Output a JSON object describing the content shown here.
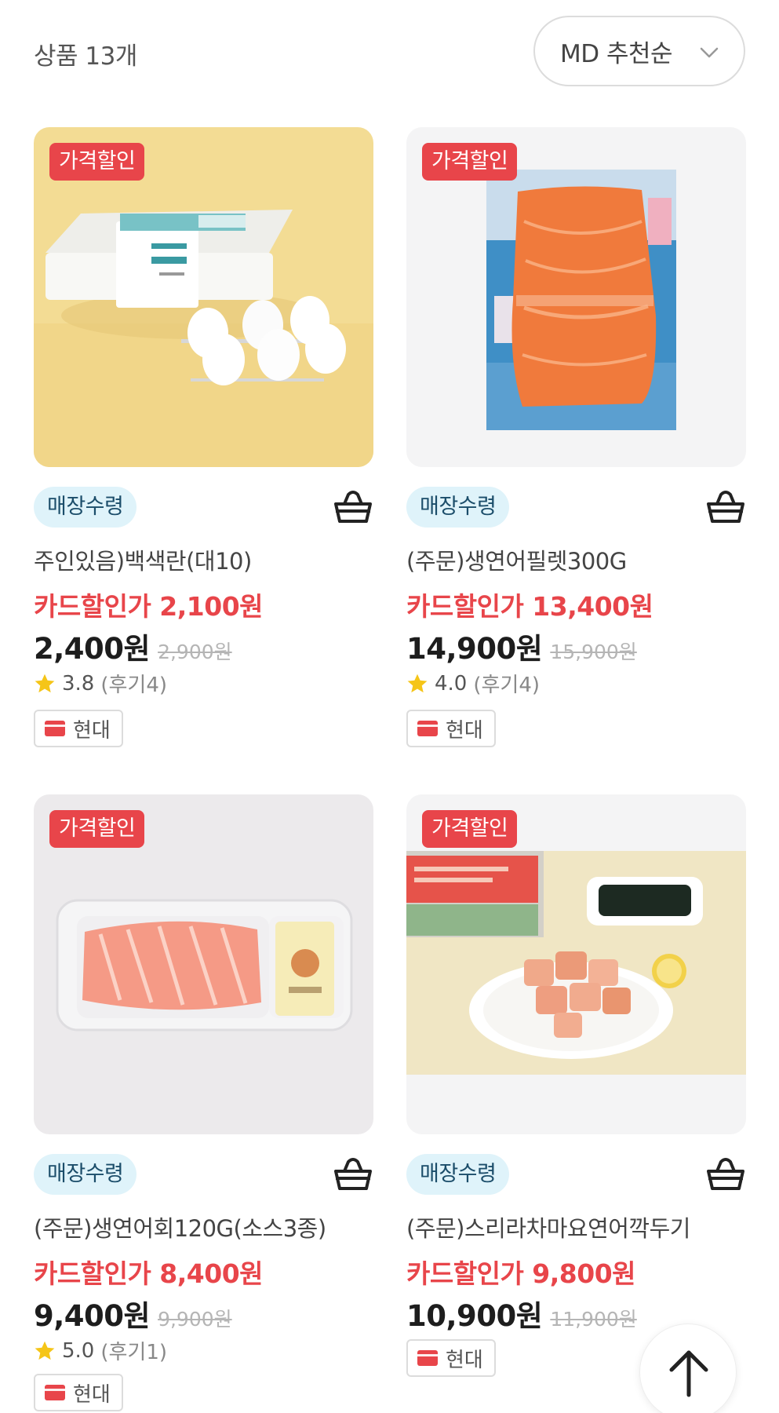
{
  "header": {
    "count_label": "상품 13개",
    "sort_label": "MD 추천순"
  },
  "products": [
    {
      "badge": "가격할인",
      "pickup": "매장수령",
      "name": "주인있음)백색란(대10)",
      "card_price": "카드할인가 2,100원",
      "price": "2,400원",
      "original_price": "2,900원",
      "rating": "3.8",
      "reviews": "(후기4)",
      "card_tag": "현대",
      "image": "eggs-carton"
    },
    {
      "badge": "가격할인",
      "pickup": "매장수령",
      "name": "(주문)생연어필렛300G",
      "card_price": "카드할인가 13,400원",
      "price": "14,900원",
      "original_price": "15,900원",
      "rating": "4.0",
      "reviews": "(후기4)",
      "card_tag": "현대",
      "image": "salmon-fillet-pack"
    },
    {
      "badge": "가격할인",
      "pickup": "매장수령",
      "name": "(주문)생연어회120G(소스3종)",
      "card_price": "카드할인가 8,400원",
      "price": "9,400원",
      "original_price": "9,900원",
      "rating": "5.0",
      "reviews": "(후기1)",
      "card_tag": "현대",
      "image": "salmon-sashimi-tray"
    },
    {
      "badge": "가격할인",
      "pickup": "매장수령",
      "name": "(주문)스리라차마요연어깍두기",
      "card_price": "카드할인가 9,800원",
      "price": "10,900원",
      "original_price": "11,900원",
      "card_tag": "현대",
      "image": "sriracha-mayo-salmon-cubes"
    }
  ],
  "icons": {
    "sort": "chevron-down-icon",
    "cart": "basket-icon",
    "star": "star-icon",
    "card": "card-icon",
    "scroll_top": "arrow-up-icon"
  },
  "colors": {
    "accent": "#e8454a",
    "pickup_bg": "#dff3fa",
    "star": "#f5c518"
  }
}
